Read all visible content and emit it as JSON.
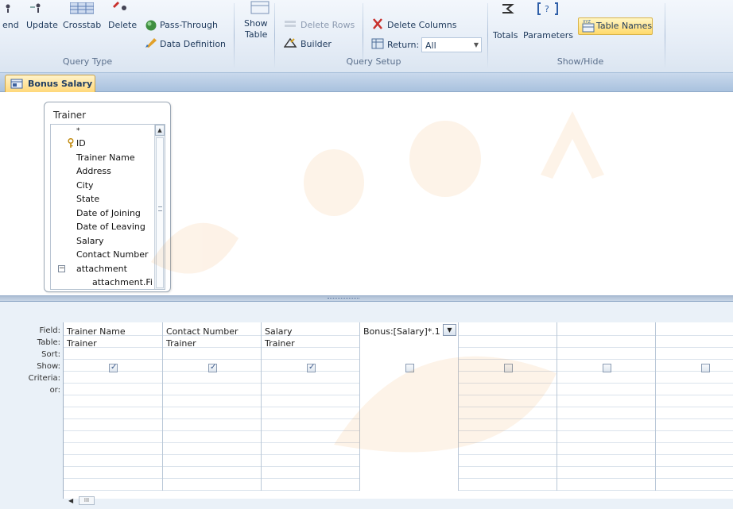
{
  "ribbon": {
    "query_type": {
      "label": "Query Type",
      "buttons": [
        "end",
        "Update",
        "Crosstab",
        "Delete"
      ],
      "pass_through": "Pass-Through",
      "data_definition": "Data Definition"
    },
    "query_setup": {
      "label": "Query Setup",
      "show_table_line1": "Show",
      "show_table_line2": "Table",
      "delete_rows": "Delete Rows",
      "builder": "Builder",
      "delete_columns": "Delete Columns",
      "return_label": "Return:",
      "return_value": "All"
    },
    "show_hide": {
      "label": "Show/Hide",
      "totals": "Totals",
      "parameters": "Parameters",
      "table_names": "Table Names"
    }
  },
  "document_tab": {
    "title": "Bonus Salary"
  },
  "table": {
    "name": "Trainer",
    "fields": [
      "*",
      "ID",
      "Trainer Name",
      "Address",
      "City",
      "State",
      "Date of Joining",
      "Date of Leaving",
      "Salary",
      "Contact Number",
      "attachment",
      "attachment.Fi"
    ]
  },
  "grid": {
    "row_labels": [
      "Field:",
      "Table:",
      "Sort:",
      "Show:",
      "Criteria:",
      "or:"
    ],
    "columns": [
      {
        "field": "Trainer Name",
        "table": "Trainer",
        "show": true
      },
      {
        "field": "Contact Number",
        "table": "Trainer",
        "show": true
      },
      {
        "field": "Salary",
        "table": "Trainer",
        "show": true
      },
      {
        "field": "Bonus:[Salary]*.1",
        "table": "",
        "show": false
      },
      {
        "field": "",
        "table": "",
        "show": false
      },
      {
        "field": "",
        "table": "",
        "show": false
      },
      {
        "field": "",
        "table": "",
        "show": false
      }
    ]
  },
  "scroll": {
    "thumb_glyph": "III"
  },
  "colors": {
    "accent": "#ffd87a",
    "ribbon": "#dbe5f1",
    "grid_border": "#9fb0c4"
  }
}
